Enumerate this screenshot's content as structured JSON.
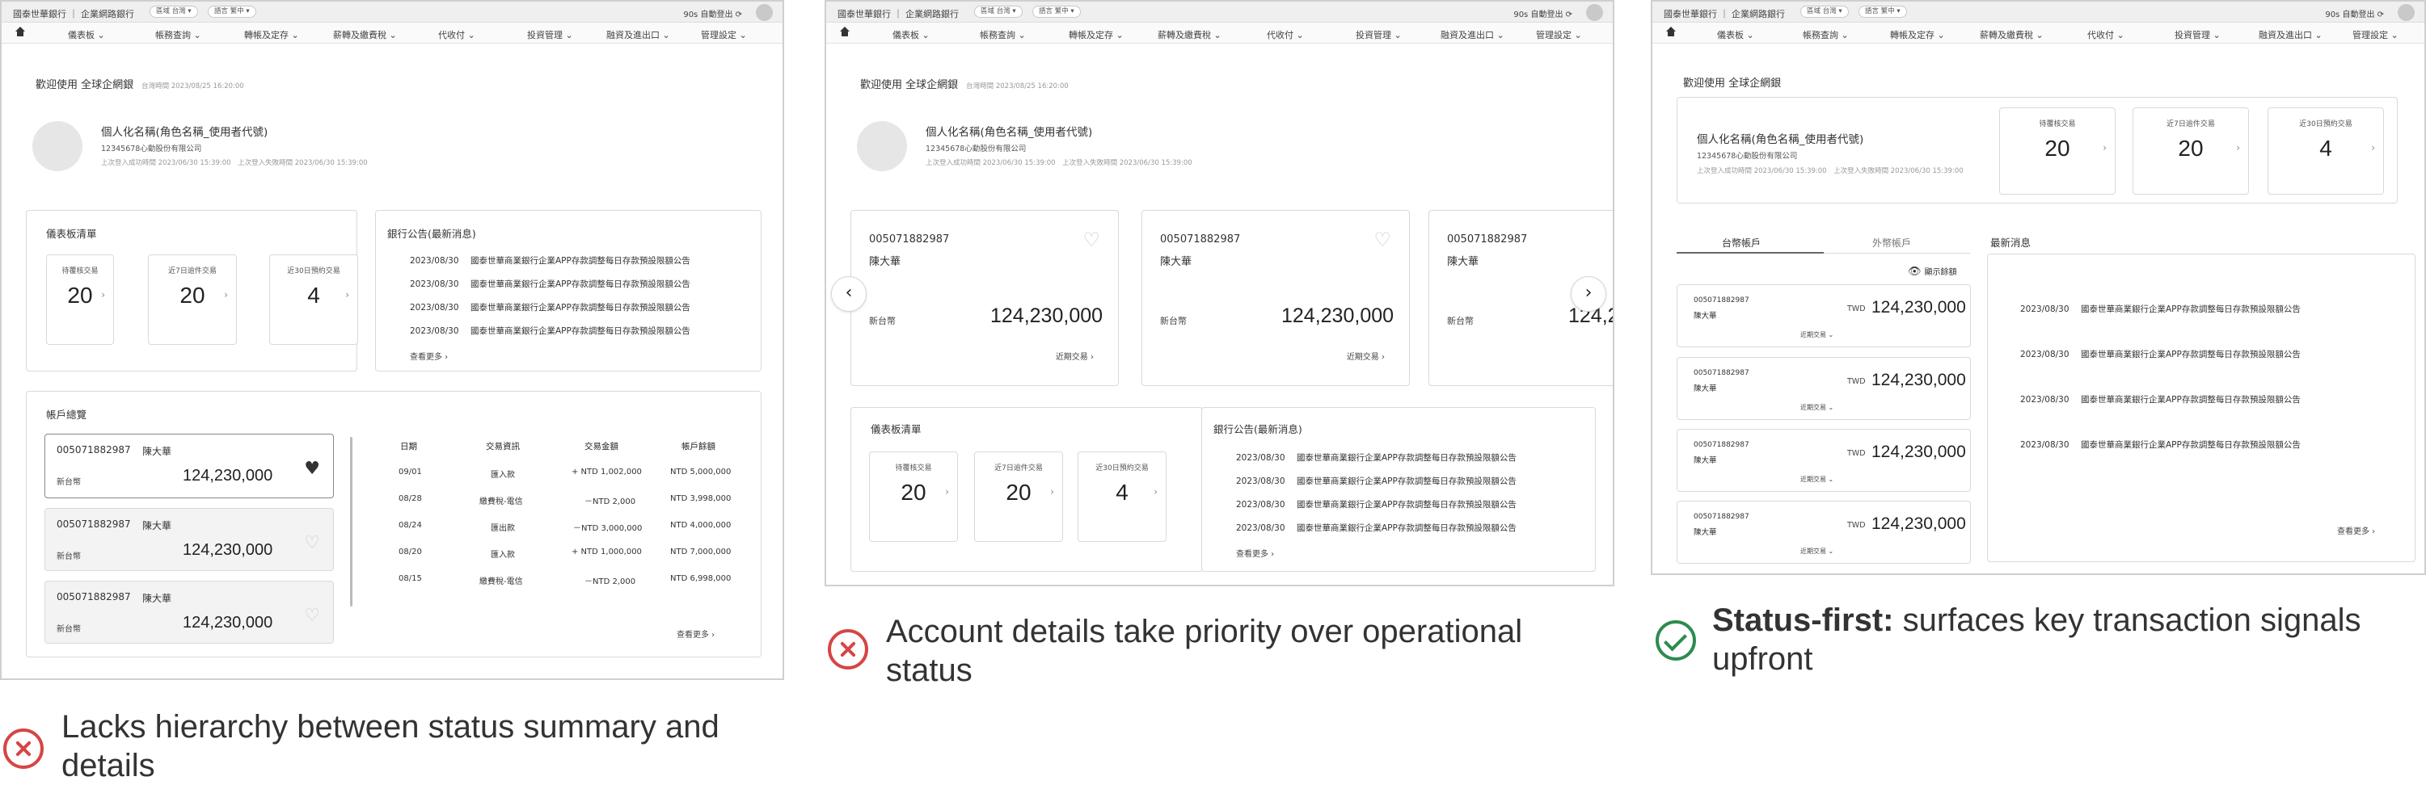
{
  "shared": {
    "bank": "國泰世華銀行 ｜ 企業網路銀行",
    "pill_region": "區域 台灣 ▾",
    "pill_lang": "語言 繁中 ▾",
    "logout": "90s 自動登出 ⟳",
    "nav": [
      "儀表板 ⌄",
      "帳務查詢 ⌄",
      "轉帳及定存 ⌄",
      "薪轉及繳費稅 ⌄",
      "代收付 ⌄",
      "投資管理 ⌄",
      "融資及進出口 ⌄",
      "管理設定 ⌄"
    ],
    "welcome": "歡迎使用 全球企網銀",
    "welcome_time": "台灣時間 2023/08/25 16:20:00",
    "user_name": "個人化名稱(角色名稱_使用者代號)",
    "company": "12345678心動股份有限公司",
    "login_info": "上次登入成功時間 2023/06/30 15:39:00　上次登入失敗時間 2023/06/30 15:39:00",
    "dashboard_title": "儀表板清單",
    "stats": [
      {
        "label": "待覆核交易",
        "value": "20"
      },
      {
        "label": "近7日逾件交易",
        "value": "20"
      },
      {
        "label": "近30日預約交易",
        "value": "4"
      }
    ],
    "notice_title": "銀行公告(最新消息)",
    "notice_date": "2023/08/30",
    "notice_text": "國泰世華商業銀行企業APP存款調整每日存款預設限額公告",
    "see_more": "查看更多 ›",
    "account_no": "005071882987",
    "account_name": "陳大華",
    "currency": "新台幣",
    "balance": "124,230,000",
    "recent_tx": "近期交易 ›",
    "heart": "♥",
    "carousel_prev": "‹",
    "carousel_next": "›"
  },
  "panel1": {
    "overview_title": "帳戶總覽",
    "tx_headers": [
      "日期",
      "交易資訊",
      "交易金額",
      "帳戶餘額"
    ],
    "tx_rows": [
      [
        "09/01",
        "匯入款",
        "+ NTD 1,002,000",
        "NTD 5,000,000"
      ],
      [
        "08/28",
        "繳費稅-電信",
        "－NTD 2,000",
        "NTD 3,998,000"
      ],
      [
        "08/24",
        "匯出款",
        "－NTD 3,000,000",
        "NTD 4,000,000"
      ],
      [
        "08/20",
        "匯入款",
        "+ NTD 1,000,000",
        "NTD 7,000,000"
      ],
      [
        "08/15",
        "繳費稅-電信",
        "－NTD 2,000",
        "NTD 6,998,000"
      ]
    ],
    "caption": "Lacks hierarchy between status summary and details"
  },
  "panel2": {
    "caption": "Account details take priority over operational status"
  },
  "panel3": {
    "tab_tw": "台幣帳戶",
    "tab_fx": "外幣帳戶",
    "show_balance": "顯示餘額",
    "twd": "TWD",
    "recent_tx": "近期交易 ⌄",
    "news_title": "最新消息",
    "caption_bold": "Status-first:",
    "caption_rest": " surfaces key transaction signals upfront"
  }
}
